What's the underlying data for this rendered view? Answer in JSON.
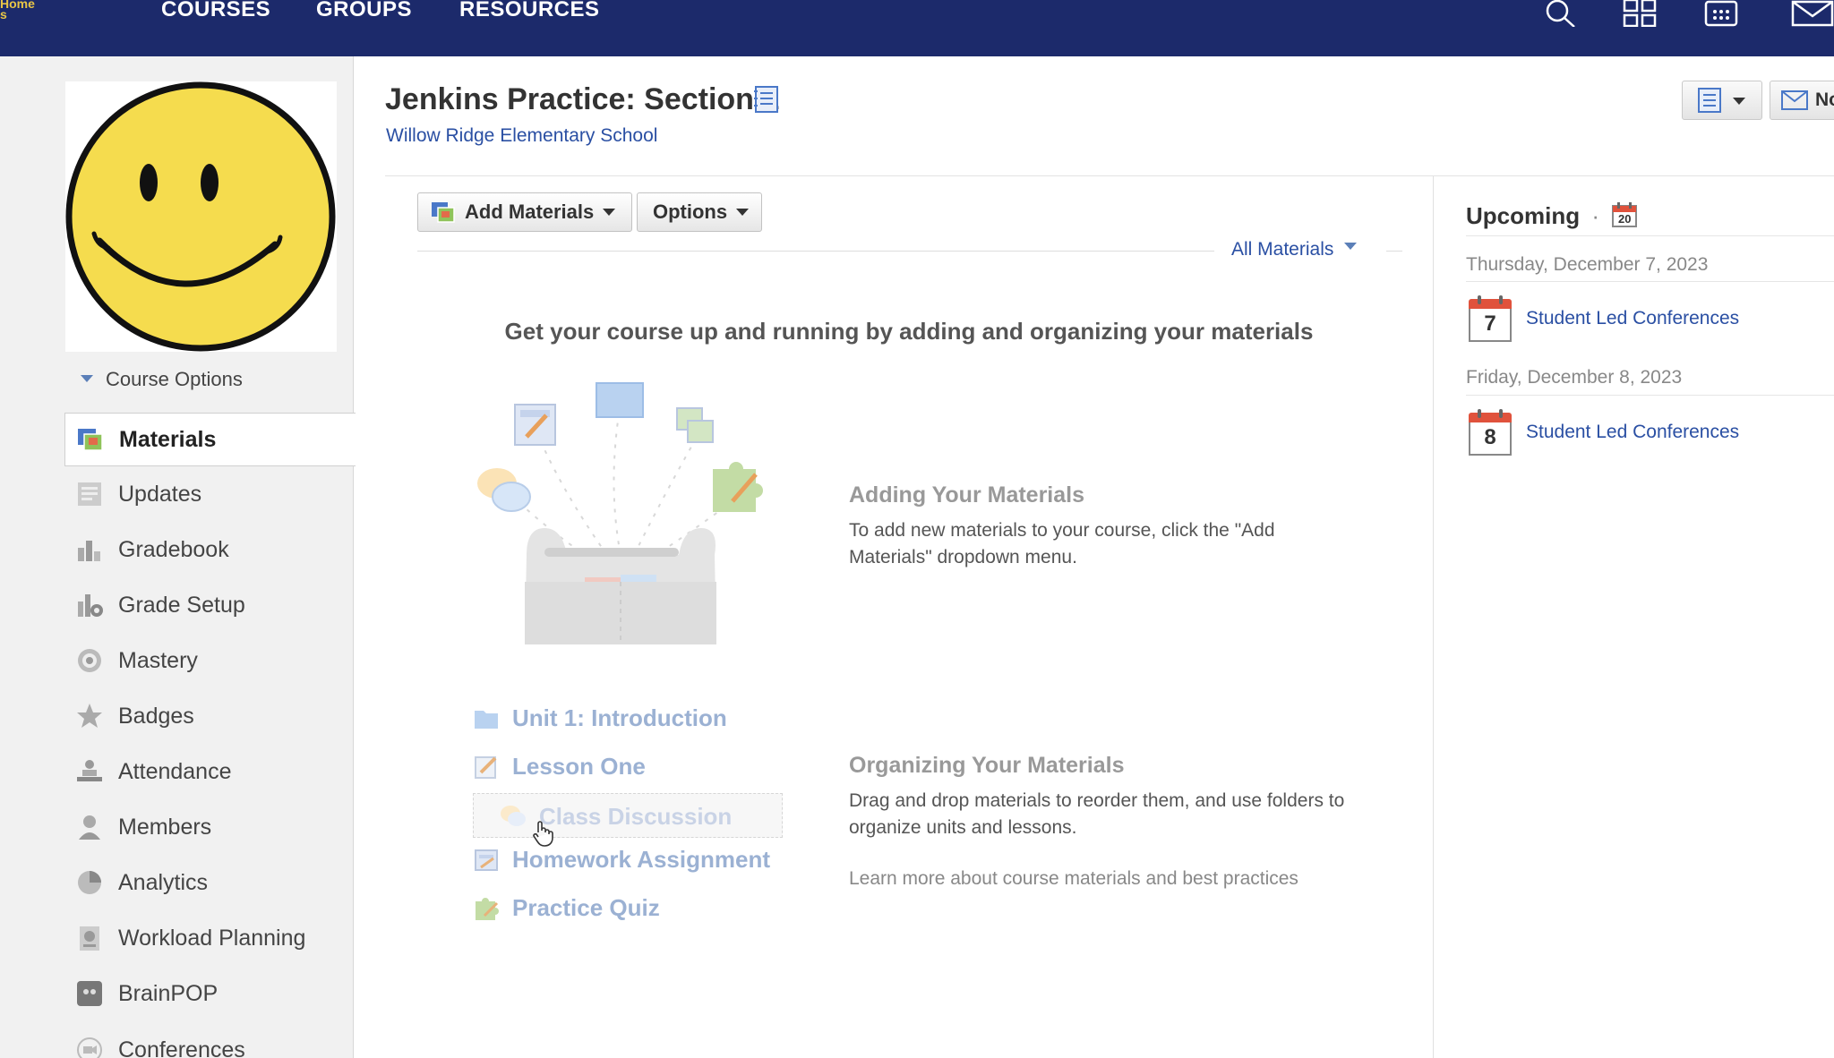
{
  "topnav": {
    "logo_line1": "Home",
    "logo_line2": "s",
    "courses": "COURSES",
    "groups": "GROUPS",
    "resources": "RESOURCES",
    "icons": [
      "search-icon",
      "apps-grid-icon",
      "calendar-icon",
      "mail-icon"
    ]
  },
  "sidebar": {
    "course_options": "Course Options",
    "items": [
      {
        "label": "Materials",
        "icon": "materials-icon",
        "active": true
      },
      {
        "label": "Updates",
        "icon": "updates-icon"
      },
      {
        "label": "Gradebook",
        "icon": "gradebook-icon"
      },
      {
        "label": "Grade Setup",
        "icon": "grade-setup-icon"
      },
      {
        "label": "Mastery",
        "icon": "mastery-icon"
      },
      {
        "label": "Badges",
        "icon": "badges-icon"
      },
      {
        "label": "Attendance",
        "icon": "attendance-icon"
      },
      {
        "label": "Members",
        "icon": "members-icon"
      },
      {
        "label": "Analytics",
        "icon": "analytics-icon"
      },
      {
        "label": "Workload Planning",
        "icon": "workload-icon"
      },
      {
        "label": "BrainPOP",
        "icon": "brainpop-icon"
      },
      {
        "label": "Conferences",
        "icon": "conferences-icon"
      }
    ]
  },
  "header": {
    "title": "Jenkins Practice: Section 1",
    "school": "Willow Ridge Elementary School",
    "notify_label": "No"
  },
  "toolbar": {
    "add_materials": "Add Materials",
    "options": "Options",
    "filter": "All Materials"
  },
  "empty_state": {
    "heading": "Get your course up and running by adding and organizing your materials",
    "adding_title": "Adding Your Materials",
    "adding_text": "To add new materials to your course, click the \"Add Materials\" dropdown menu.",
    "organizing_title": "Organizing Your Materials",
    "organizing_text": "Drag and drop materials to reorder them, and use folders to organize units and lessons.",
    "learn_more": "Learn more about course materials and best practices",
    "sample_items": [
      {
        "label": "Unit 1: Introduction",
        "icon": "folder-icon"
      },
      {
        "label": "Lesson One",
        "icon": "page-icon"
      },
      {
        "label": "Class Discussion",
        "icon": "discussion-icon"
      },
      {
        "label": "Homework Assignment",
        "icon": "assignment-icon"
      },
      {
        "label": "Practice Quiz",
        "icon": "quiz-icon"
      }
    ]
  },
  "upcoming": {
    "title": "Upcoming",
    "separator": "·",
    "calendar_badge": "20",
    "days": [
      {
        "date": "Thursday, December 7, 2023",
        "day_num": "7",
        "event": "Student Led Conferences"
      },
      {
        "date": "Friday, December 8, 2023",
        "day_num": "8",
        "event": "Student Led Conferences"
      }
    ]
  },
  "colors": {
    "nav_bg": "#1c2a6b",
    "link": "#2a4fa3",
    "smiley": "#f5dc4e",
    "calendar_red": "#e0523c"
  }
}
